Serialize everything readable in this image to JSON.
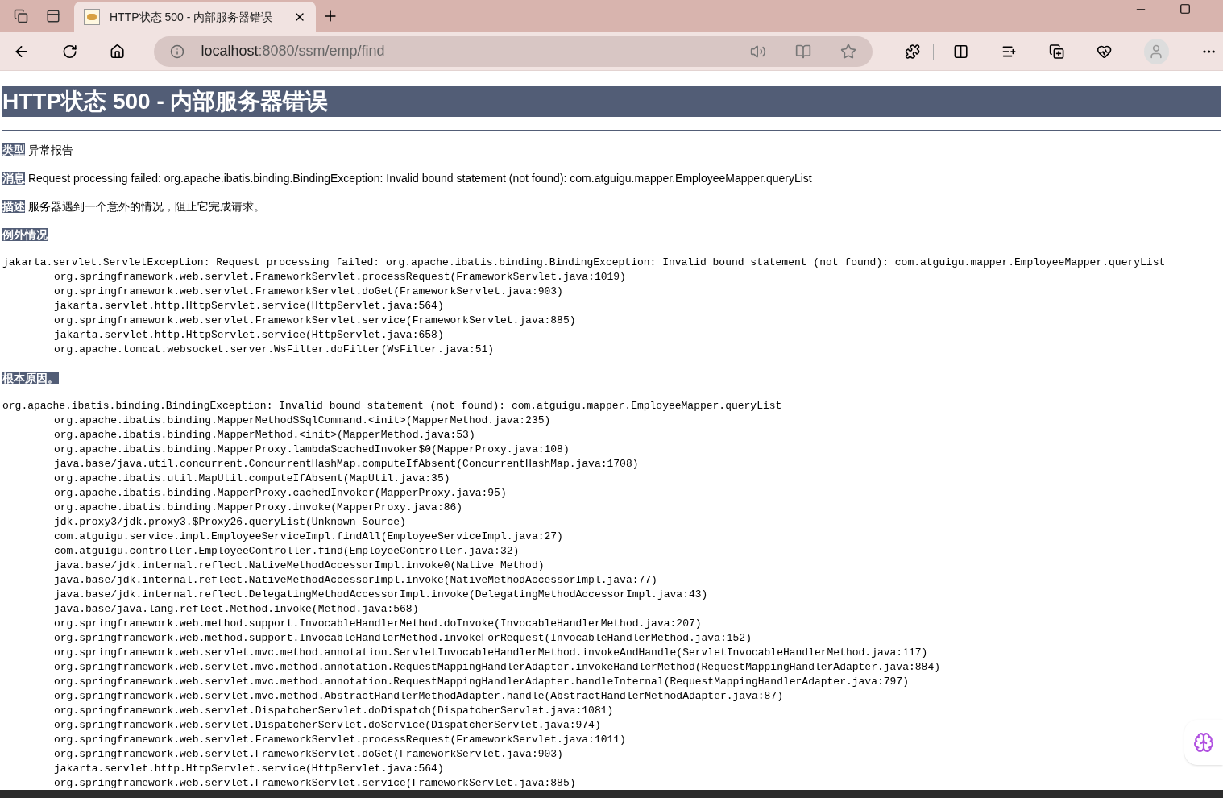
{
  "browser": {
    "tab": {
      "title": "HTTP状态 500 - 内部服务器错误",
      "selected": true
    },
    "address": {
      "host": "localhost",
      "path": ":8080/ssm/emp/find"
    }
  },
  "page": {
    "title": "HTTP状态 500 - 内部服务器错误",
    "fields": [
      {
        "label": "类型",
        "text": "异常报告"
      },
      {
        "label": "消息",
        "text": "Request processing failed: org.apache.ibatis.binding.BindingException: Invalid bound statement (not found): com.atguigu.mapper.EmployeeMapper.queryList"
      },
      {
        "label": "描述",
        "text": "服务器遇到一个意外的情况，阻止它完成请求。"
      }
    ],
    "sections": [
      {
        "heading": "例外情况",
        "exception": "jakarta.servlet.ServletException: Request processing failed: org.apache.ibatis.binding.BindingException: Invalid bound statement (not found): com.atguigu.mapper.EmployeeMapper.queryList",
        "frames": [
          "org.springframework.web.servlet.FrameworkServlet.processRequest(FrameworkServlet.java:1019)",
          "org.springframework.web.servlet.FrameworkServlet.doGet(FrameworkServlet.java:903)",
          "jakarta.servlet.http.HttpServlet.service(HttpServlet.java:564)",
          "org.springframework.web.servlet.FrameworkServlet.service(FrameworkServlet.java:885)",
          "jakarta.servlet.http.HttpServlet.service(HttpServlet.java:658)",
          "org.apache.tomcat.websocket.server.WsFilter.doFilter(WsFilter.java:51)"
        ]
      },
      {
        "heading": "根本原因。",
        "exception": "org.apache.ibatis.binding.BindingException: Invalid bound statement (not found): com.atguigu.mapper.EmployeeMapper.queryList",
        "frames": [
          "org.apache.ibatis.binding.MapperMethod$SqlCommand.<init>(MapperMethod.java:235)",
          "org.apache.ibatis.binding.MapperMethod.<init>(MapperMethod.java:53)",
          "org.apache.ibatis.binding.MapperProxy.lambda$cachedInvoker$0(MapperProxy.java:108)",
          "java.base/java.util.concurrent.ConcurrentHashMap.computeIfAbsent(ConcurrentHashMap.java:1708)",
          "org.apache.ibatis.util.MapUtil.computeIfAbsent(MapUtil.java:35)",
          "org.apache.ibatis.binding.MapperProxy.cachedInvoker(MapperProxy.java:95)",
          "org.apache.ibatis.binding.MapperProxy.invoke(MapperProxy.java:86)",
          "jdk.proxy3/jdk.proxy3.$Proxy26.queryList(Unknown Source)",
          "com.atguigu.service.impl.EmployeeServiceImpl.findAll(EmployeeServiceImpl.java:27)",
          "com.atguigu.controller.EmployeeController.find(EmployeeController.java:32)",
          "java.base/jdk.internal.reflect.NativeMethodAccessorImpl.invoke0(Native Method)",
          "java.base/jdk.internal.reflect.NativeMethodAccessorImpl.invoke(NativeMethodAccessorImpl.java:77)",
          "java.base/jdk.internal.reflect.DelegatingMethodAccessorImpl.invoke(DelegatingMethodAccessorImpl.java:43)",
          "java.base/java.lang.reflect.Method.invoke(Method.java:568)",
          "org.springframework.web.method.support.InvocableHandlerMethod.doInvoke(InvocableHandlerMethod.java:207)",
          "org.springframework.web.method.support.InvocableHandlerMethod.invokeForRequest(InvocableHandlerMethod.java:152)",
          "org.springframework.web.servlet.mvc.method.annotation.ServletInvocableHandlerMethod.invokeAndHandle(ServletInvocableHandlerMethod.java:117)",
          "org.springframework.web.servlet.mvc.method.annotation.RequestMappingHandlerAdapter.invokeHandlerMethod(RequestMappingHandlerAdapter.java:884)",
          "org.springframework.web.servlet.mvc.method.annotation.RequestMappingHandlerAdapter.handleInternal(RequestMappingHandlerAdapter.java:797)",
          "org.springframework.web.servlet.mvc.method.AbstractHandlerMethodAdapter.handle(AbstractHandlerMethodAdapter.java:87)",
          "org.springframework.web.servlet.DispatcherServlet.doDispatch(DispatcherServlet.java:1081)",
          "org.springframework.web.servlet.DispatcherServlet.doService(DispatcherServlet.java:974)",
          "org.springframework.web.servlet.FrameworkServlet.processRequest(FrameworkServlet.java:1011)",
          "org.springframework.web.servlet.FrameworkServlet.doGet(FrameworkServlet.java:903)",
          "jakarta.servlet.http.HttpServlet.service(HttpServlet.java:564)",
          "org.springframework.web.servlet.FrameworkServlet.service(FrameworkServlet.java:885)"
        ]
      }
    ]
  }
}
